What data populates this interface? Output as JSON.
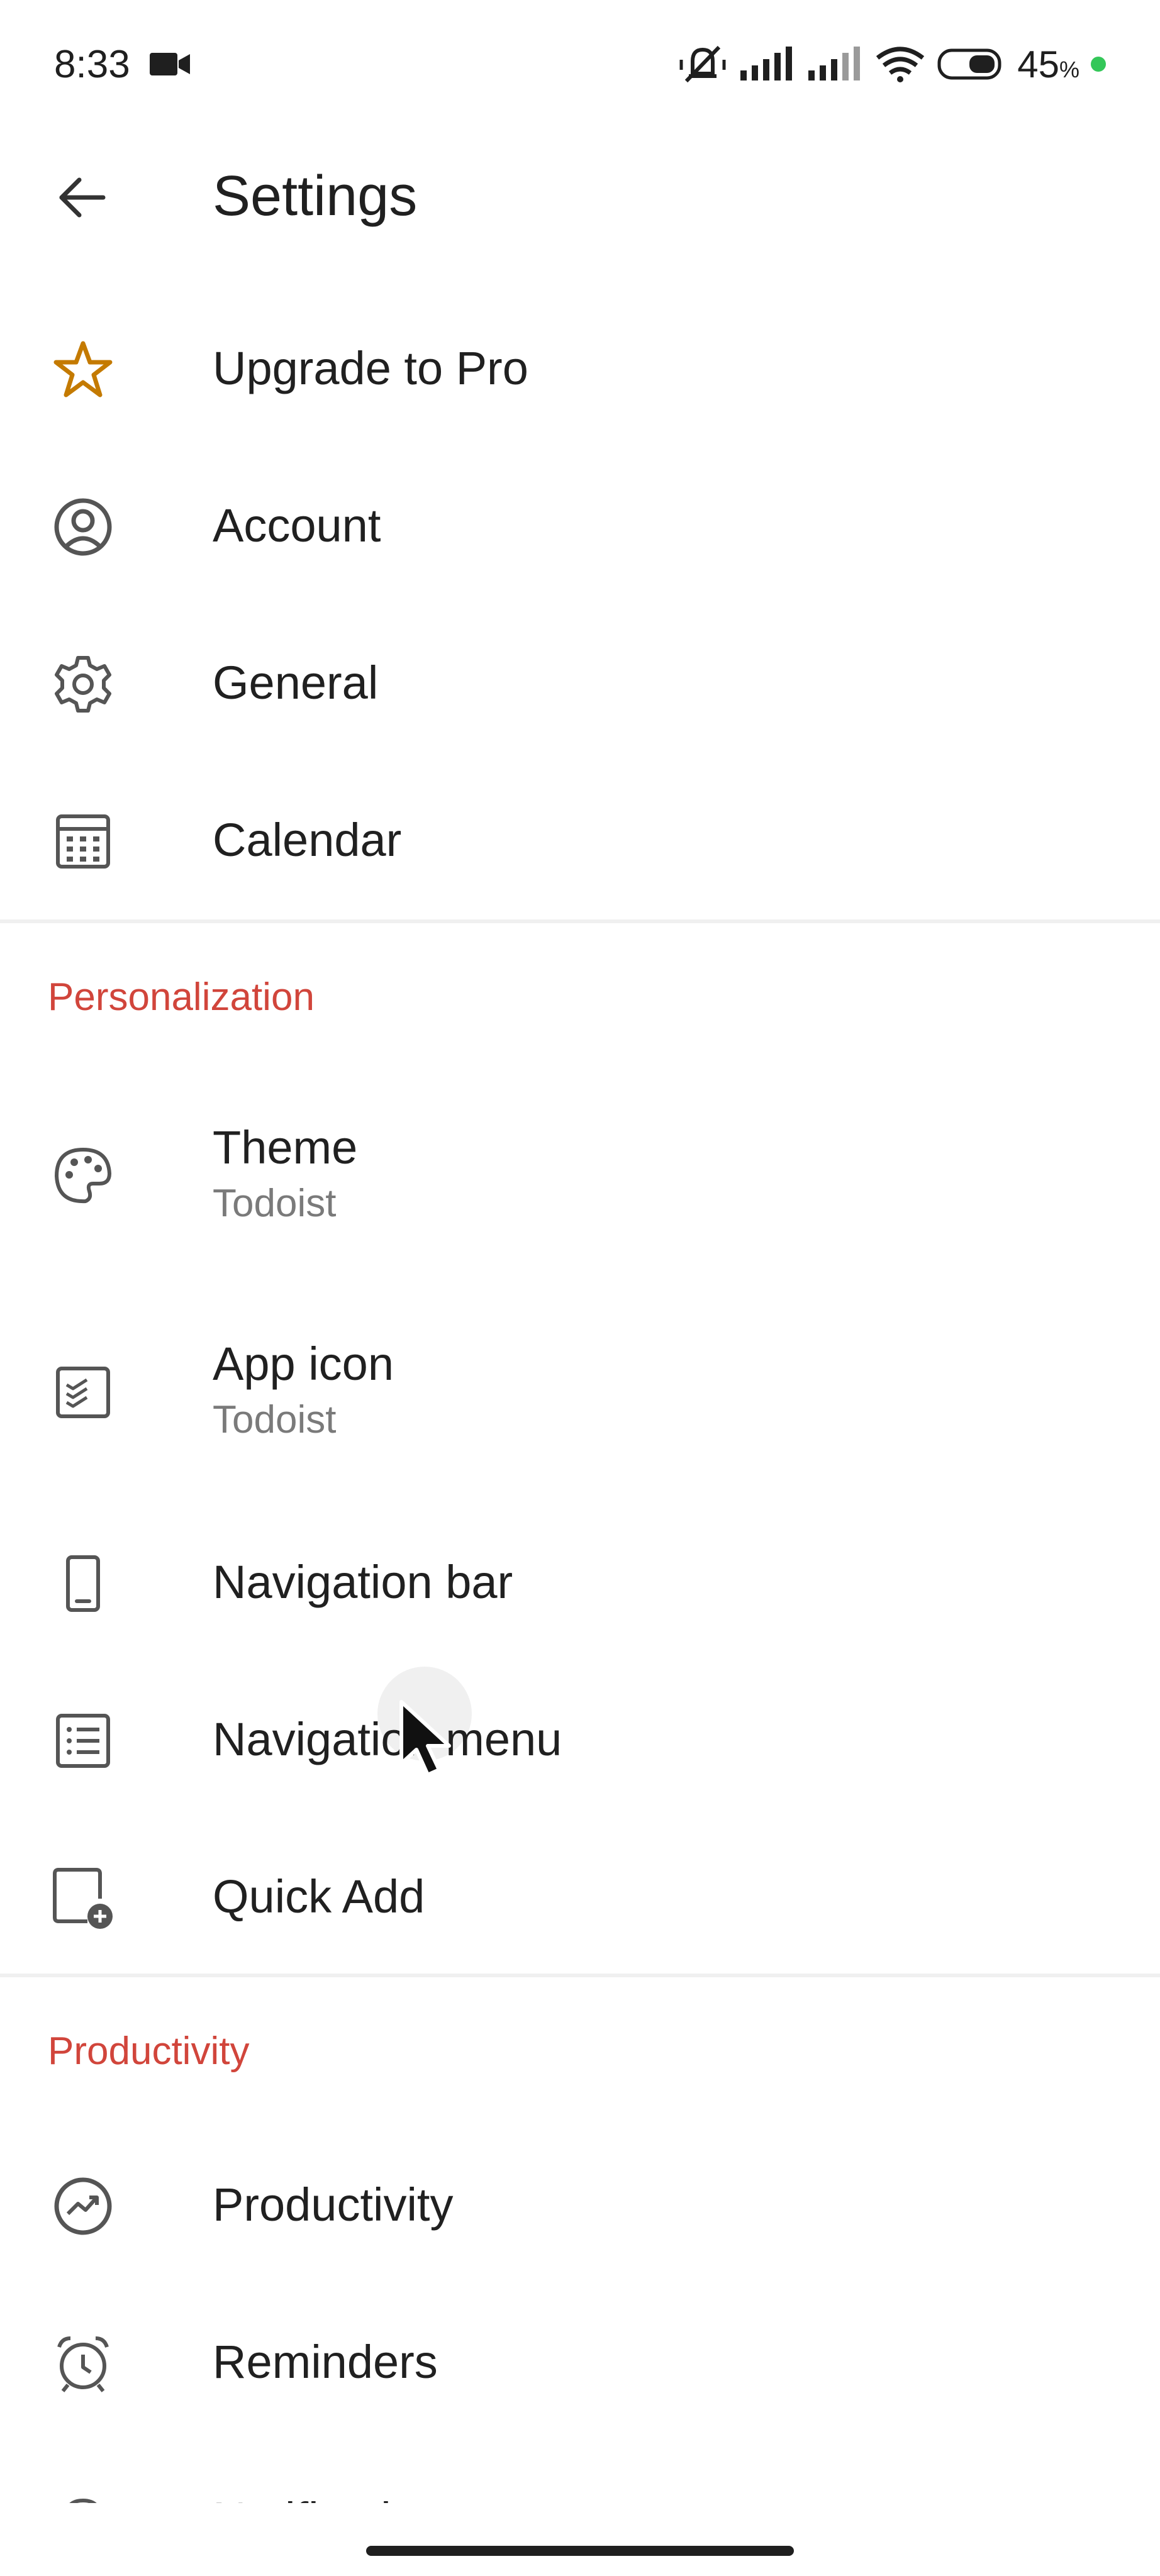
{
  "status_bar": {
    "time": "8:33",
    "battery_percent": "45",
    "battery_unit": "%"
  },
  "header": {
    "title": "Settings"
  },
  "colors": {
    "accent": "#d1453b",
    "upgrade_star": "#c47a00"
  },
  "items_top": [
    {
      "label": "Upgrade to Pro",
      "icon": "star-icon"
    },
    {
      "label": "Account",
      "icon": "account-icon"
    },
    {
      "label": "General",
      "icon": "gear-icon"
    },
    {
      "label": "Calendar",
      "icon": "calendar-icon"
    }
  ],
  "personalization": {
    "title": "Personalization",
    "items": [
      {
        "label": "Theme",
        "value": "Todoist",
        "icon": "palette-icon"
      },
      {
        "label": "App icon",
        "value": "Todoist",
        "icon": "app-icon-icon"
      },
      {
        "label": "Navigation bar",
        "icon": "phone-icon"
      },
      {
        "label": "Navigation menu",
        "icon": "list-icon"
      },
      {
        "label": "Quick Add",
        "icon": "quick-add-icon"
      }
    ]
  },
  "productivity": {
    "title": "Productivity",
    "items": [
      {
        "label": "Productivity",
        "icon": "trend-icon"
      },
      {
        "label": "Reminders",
        "icon": "alarm-icon"
      },
      {
        "label": "Notifications",
        "icon": "bell-icon"
      }
    ]
  }
}
